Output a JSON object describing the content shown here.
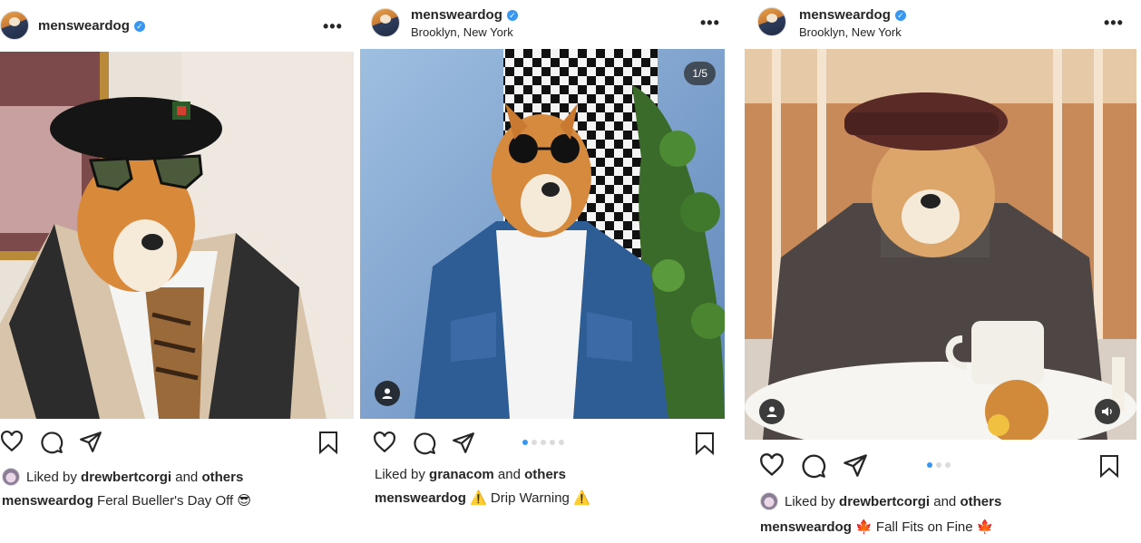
{
  "posts": [
    {
      "username": "mensweardog",
      "verified_badge": "✓",
      "location": "",
      "more_icon": "•••",
      "counter": "",
      "liked_by_prefix": "Liked by",
      "liked_by_user": "drewbertcorgi",
      "liked_by_and": "and",
      "liked_by_others": "others",
      "caption_user": "mensweardog",
      "caption_text": "Feral Bueller's Day Off",
      "caption_emoji_start": "",
      "caption_emoji_end": "😎",
      "carousel_dots": 0,
      "active_dot": 0
    },
    {
      "username": "mensweardog",
      "verified_badge": "✓",
      "location": "Brooklyn, New York",
      "more_icon": "•••",
      "counter": "1/5",
      "liked_by_prefix": "Liked by",
      "liked_by_user": "granacom",
      "liked_by_and": "and",
      "liked_by_others": "others",
      "caption_user": "mensweardog",
      "caption_text": "Drip Warning",
      "caption_emoji_start": "⚠️",
      "caption_emoji_end": "⚠️",
      "carousel_dots": 5,
      "active_dot": 0
    },
    {
      "username": "mensweardog",
      "verified_badge": "✓",
      "location": "Brooklyn, New York",
      "more_icon": "•••",
      "counter": "",
      "liked_by_prefix": "Liked by",
      "liked_by_user": "drewbertcorgi",
      "liked_by_and": "and",
      "liked_by_others": "others",
      "caption_user": "mensweardog",
      "caption_text": "Fall Fits on Fine",
      "caption_emoji_start": "🍁",
      "caption_emoji_end": "🍁",
      "carousel_dots": 3,
      "active_dot": 0
    }
  ],
  "icons": {
    "like": "heart-icon",
    "comment": "comment-icon",
    "share": "paper-plane-icon",
    "save": "bookmark-icon",
    "tag": "user-tag-icon",
    "audio": "speaker-icon"
  },
  "colors": {
    "verified": "#3897f0",
    "dot_active": "#3897f0",
    "dot_inactive": "#dbdbdb",
    "text": "#262626"
  }
}
